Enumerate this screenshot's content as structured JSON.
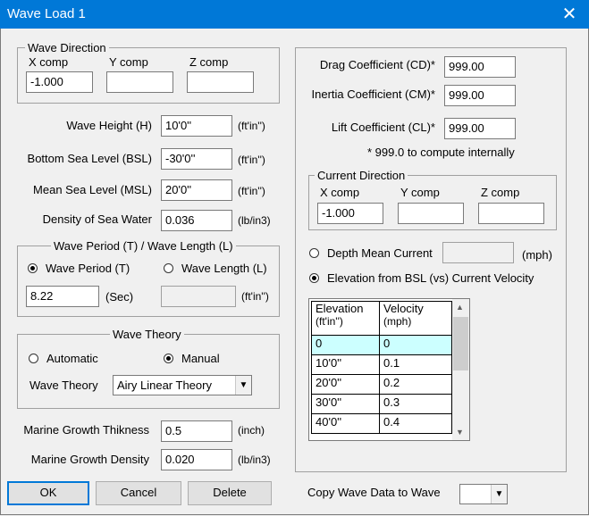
{
  "window": {
    "title": "Wave Load 1",
    "close_glyph": "✕"
  },
  "wave_direction": {
    "label": "Wave Direction",
    "x_label": "X comp",
    "y_label": "Y comp",
    "z_label": "Z comp",
    "x_value": "-1.000",
    "y_value": "",
    "z_value": ""
  },
  "wave_height": {
    "label": "Wave Height (H)",
    "value": "10'0''",
    "unit": "(ft'in'')"
  },
  "bsl": {
    "label": "Bottom Sea Level (BSL)",
    "value": "-30'0''",
    "unit": "(ft'in'')"
  },
  "msl": {
    "label": "Mean Sea Level (MSL)",
    "value": "20'0''",
    "unit": "(ft'in'')"
  },
  "density": {
    "label": "Density of Sea Water",
    "value": "0.036",
    "unit": "(lb/in3)"
  },
  "wave_period": {
    "group_label": "Wave Period (T) / Wave Length (L)",
    "period_label": "Wave Period (T)",
    "length_label": "Wave Length (L)",
    "period_value": "8.22",
    "period_unit": "(Sec)",
    "length_value": "",
    "length_unit": "(ft'in'')",
    "selected": "period"
  },
  "wave_theory": {
    "group_label": "Wave Theory",
    "auto_label": "Automatic",
    "manual_label": "Manual",
    "selected": "manual",
    "combo_label": "Wave Theory",
    "combo_value": "Airy Linear Theory"
  },
  "marine_growth": {
    "thickness_label": "Marine Growth Thikness",
    "thickness_value": "0.5",
    "thickness_unit": "(inch)",
    "density_label": "Marine Growth Density",
    "density_value": "0.020",
    "density_unit": "(lb/in3)"
  },
  "coefficients": {
    "cd_label": "Drag Coefficient (CD)*",
    "cd_value": "999.00",
    "cm_label": "Inertia Coefficient (CM)*",
    "cm_value": "999.00",
    "cl_label": "Lift Coefficient (CL)*",
    "cl_value": "999.00",
    "note": "* 999.0 to compute internally"
  },
  "current_direction": {
    "label": "Current Direction",
    "x_label": "X comp",
    "y_label": "Y comp",
    "z_label": "Z comp",
    "x_value": "-1.000",
    "y_value": "",
    "z_value": ""
  },
  "current_mode": {
    "depth_label": "Depth Mean Current",
    "depth_value": "",
    "depth_unit": "(mph)",
    "elev_label": "Elevation from BSL (vs) Current Velocity",
    "selected": "elevation"
  },
  "velocity_table": {
    "headers": [
      {
        "line1": "Elevation",
        "line2": "(ft'in'')"
      },
      {
        "line1": "Velocity",
        "line2": "(mph)"
      }
    ],
    "rows": [
      {
        "elevation": "0",
        "velocity": "0"
      },
      {
        "elevation": "10'0''",
        "velocity": "0.1"
      },
      {
        "elevation": "20'0''",
        "velocity": "0.2"
      },
      {
        "elevation": "30'0''",
        "velocity": "0.3"
      },
      {
        "elevation": "40'0''",
        "velocity": "0.4"
      }
    ],
    "scroll_up": "▲",
    "scroll_down": "▼"
  },
  "buttons": {
    "ok": "OK",
    "cancel": "Cancel",
    "delete": "Delete"
  },
  "copy": {
    "label": "Copy Wave Data to Wave",
    "value": "",
    "arrow": "▼"
  },
  "colors": {
    "titlebar": "#0078d7",
    "selected_row": "#ccffff"
  }
}
